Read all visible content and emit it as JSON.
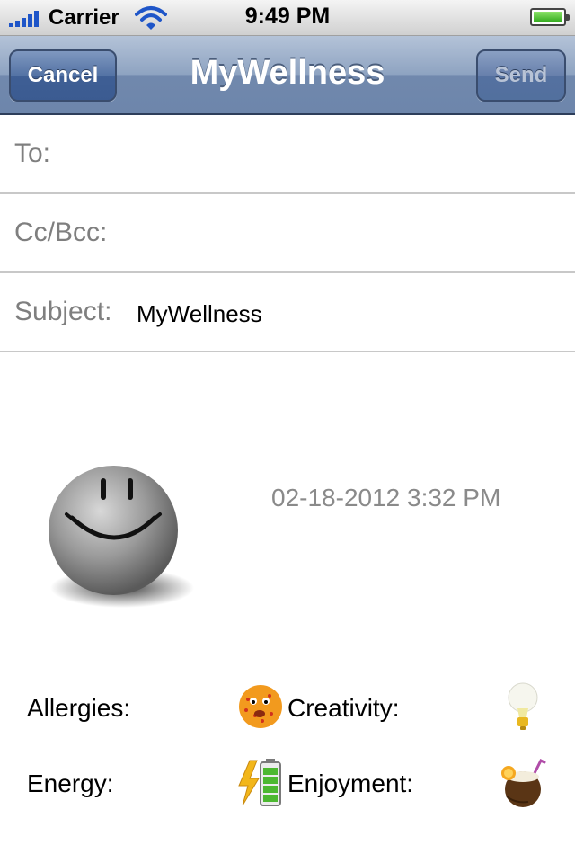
{
  "status_bar": {
    "carrier": "Carrier",
    "time": "9:49 PM",
    "icons": [
      "signal-bars-icon",
      "wifi-icon",
      "battery-icon"
    ]
  },
  "nav_bar": {
    "title": "MyWellness",
    "cancel_label": "Cancel",
    "send_label": "Send"
  },
  "form": {
    "to_label": "To:",
    "to_value": "",
    "cc_label": "Cc/Bcc:",
    "cc_value": "",
    "subject_label": "Subject:",
    "subject_value": "MyWellness"
  },
  "body": {
    "mood_icon": "smiley-face-icon",
    "timestamp": "02-18-2012 3:32 PM",
    "ratings": [
      {
        "label": "Allergies:",
        "icon": "sneezing-face-icon"
      },
      {
        "label": "Creativity:",
        "icon": "lightbulb-icon"
      },
      {
        "label": "Energy:",
        "icon": "battery-charging-icon"
      },
      {
        "label": "Enjoyment:",
        "icon": "coconut-drink-icon"
      }
    ]
  },
  "colors": {
    "nav_bar": "#7a8fb1",
    "button": "#4a6aa0",
    "field_label": "#7f7f7f",
    "timestamp": "#8a8a8a"
  }
}
